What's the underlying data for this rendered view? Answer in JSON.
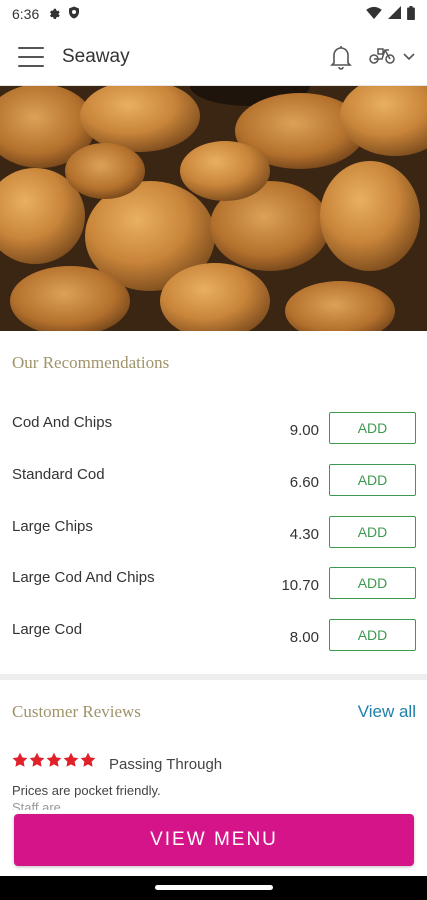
{
  "status_bar": {
    "time": "6:36"
  },
  "app_bar": {
    "title": "Seaway",
    "menu_icon": "hamburger-menu-icon",
    "bell_icon": "bell-icon",
    "delivery_icon": "scooter-icon",
    "dropdown_icon": "chevron-down-icon"
  },
  "recommendations": {
    "title": "Our Recommendations",
    "items": [
      {
        "name": "Cod And Chips",
        "price": "9.00",
        "button": "ADD"
      },
      {
        "name": "Standard Cod",
        "price": "6.60",
        "button": "ADD"
      },
      {
        "name": "Large Chips",
        "price": "4.30",
        "button": "ADD"
      },
      {
        "name": "Large Cod And Chips",
        "price": "10.70",
        "button": "ADD"
      },
      {
        "name": "Large Cod",
        "price": "8.00",
        "button": "ADD"
      }
    ]
  },
  "reviews": {
    "title": "Customer Reviews",
    "view_all": "View all",
    "rating": 5,
    "reviewer": "Passing Through",
    "text": "Prices are pocket friendly.",
    "more": "Staff are ..."
  },
  "footer": {
    "view_menu": "VIEW MENU"
  },
  "colors": {
    "accent": "#d6148a",
    "add_green": "#3c9a4f",
    "link_blue": "#1e7fa8",
    "section_gold": "#a0936a",
    "star_red": "#e0202a"
  }
}
